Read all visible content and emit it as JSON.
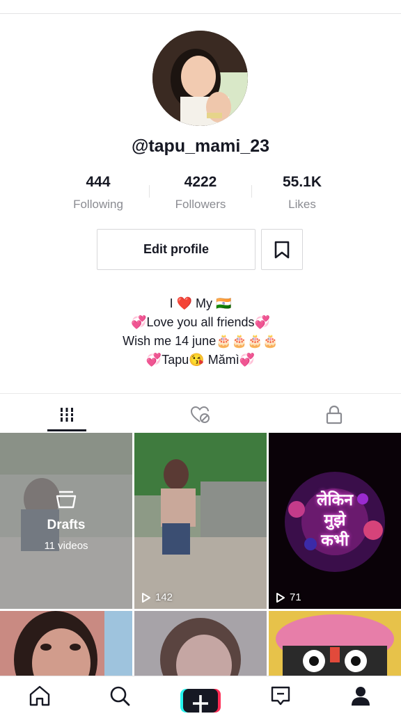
{
  "profile": {
    "username": "@tapu_mami_23",
    "stats": [
      {
        "value": "444",
        "label": "Following"
      },
      {
        "value": "4222",
        "label": "Followers"
      },
      {
        "value": "55.1K",
        "label": "Likes"
      }
    ],
    "edit_label": "Edit profile",
    "bio": [
      "I ❤️ My 🇮🇳",
      "💞Love you all friends💞",
      "Wish me 14 june🎂🎂🎂🎂",
      "💞Tapu😘 Mămì💞"
    ]
  },
  "drafts": {
    "title": "Drafts",
    "count": "11 videos"
  },
  "videos": [
    {
      "views": "142"
    },
    {
      "views": "71",
      "overlay_text": "लेकिन\nमुझे\nकभी"
    }
  ],
  "colors": {
    "text": "#161823",
    "muted": "#8a8b91",
    "accent_cyan": "#25f4ee",
    "accent_red": "#fe2c55"
  }
}
